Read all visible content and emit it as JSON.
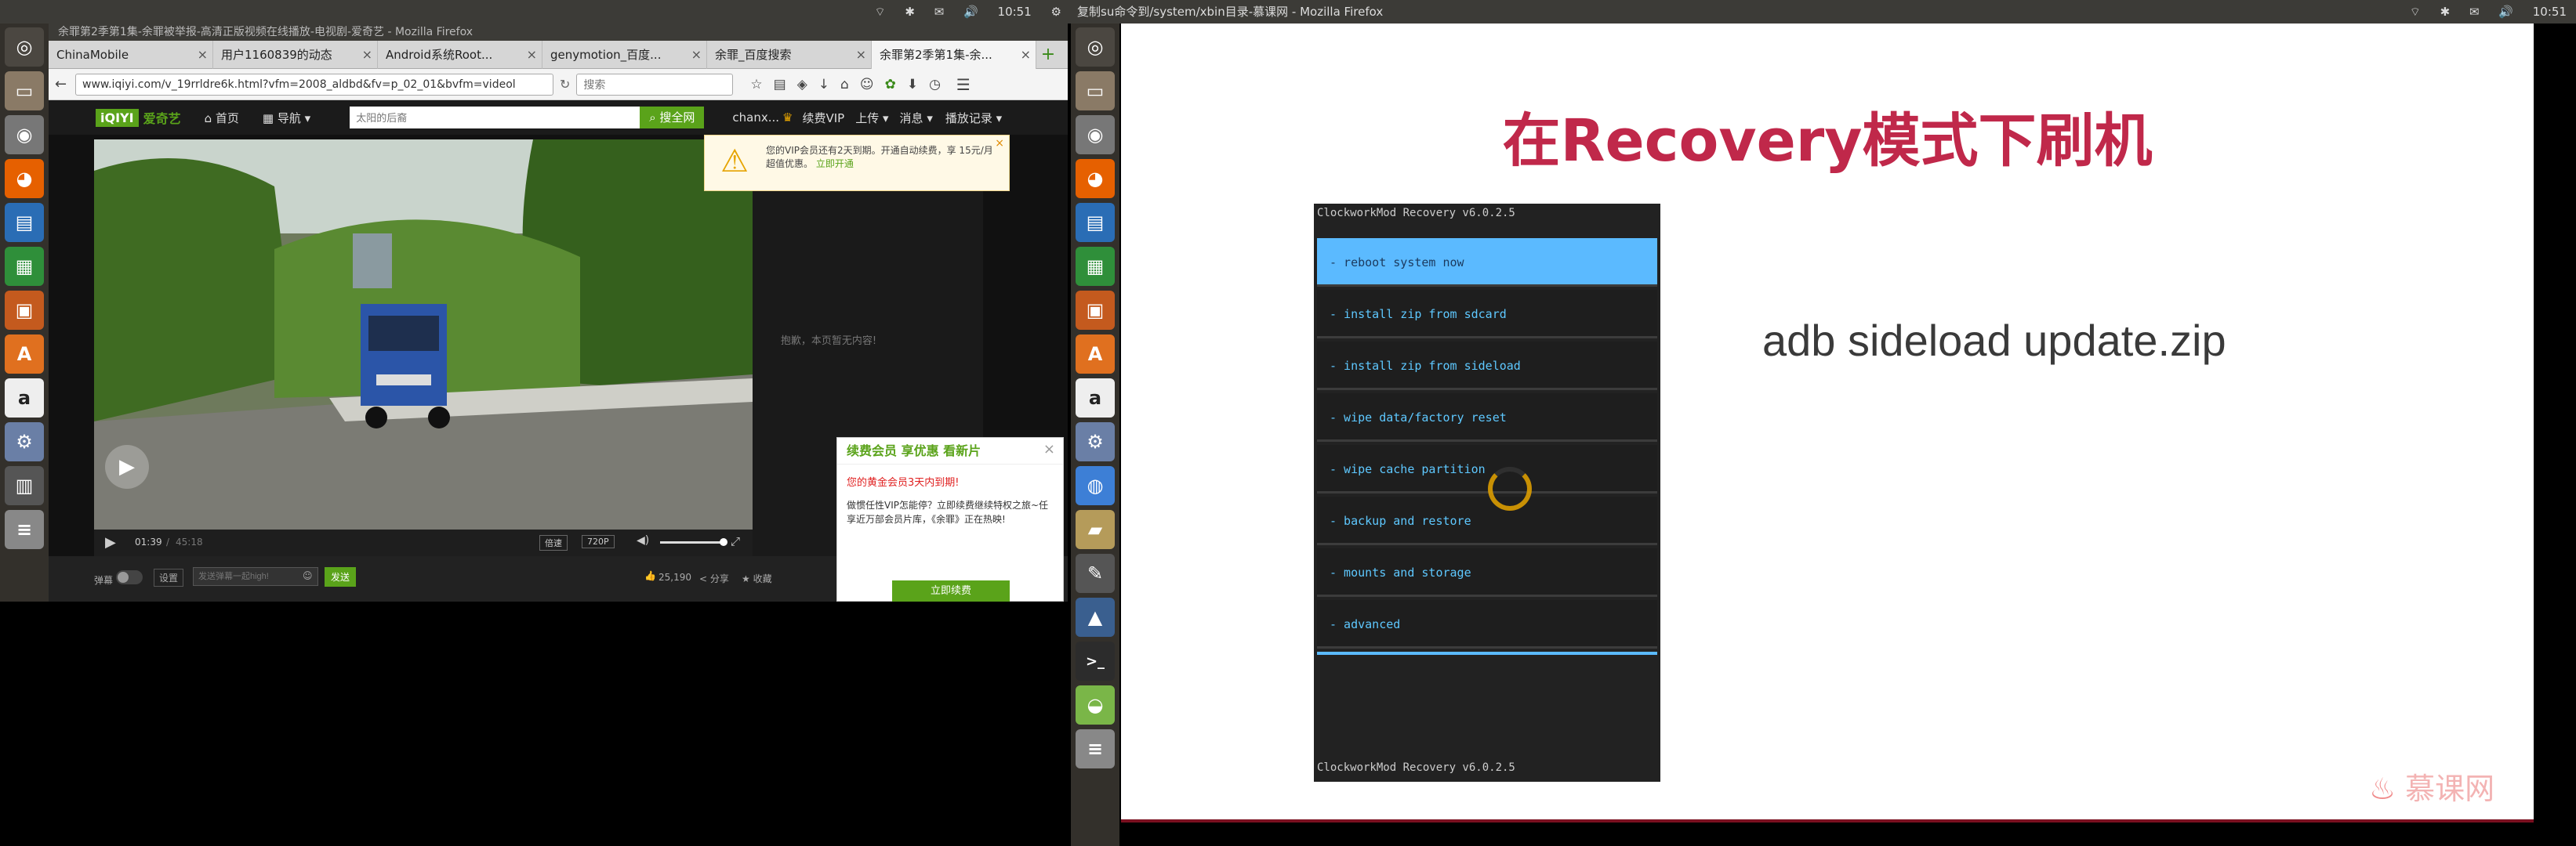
{
  "left_screen": {
    "topbar_time": "10:51",
    "window_title": "余罪第2季第1集-余罪被举报-高清正版视频在线播放-电视剧-爱奇艺 - Mozilla Firefox",
    "tabs": [
      {
        "label": "ChinaMobile"
      },
      {
        "label": "用户1160839的动态"
      },
      {
        "label": "Android系统Root..."
      },
      {
        "label": "genymotion_百度..."
      },
      {
        "label": "余罪_百度搜索"
      },
      {
        "label": "余罪第2季第1集-余..."
      }
    ],
    "url": "www.iqiyi.com/v_19rrldre6k.html?vfm=2008_aldbd&fv=p_02_01&bvfm=videol",
    "search_placeholder": "搜索",
    "iqiyi": {
      "logo": "爱奇艺",
      "nav_home": "首页",
      "nav_guide": "导航",
      "search_placeholder": "太阳的后裔",
      "search_button": "搜全网",
      "user": "chanx...",
      "renew_vip": "续费VIP",
      "upload": "上传",
      "messages": "消息",
      "history": "播放记录",
      "vip_notice": "您的VIP会员还有2天到期。开通自动续费，享 15元/月超值优惠。",
      "vip_notice_link": "立即开通",
      "side_empty": "抱歉，本页暂无内容!",
      "time_current": "01:39",
      "time_total": "45:18",
      "quality_1": "倍速",
      "quality_2": "720P",
      "danmu_label": "弹幕",
      "danmu_settings": "设置",
      "danmu_placeholder": "发送弹幕一起high!",
      "danmu_send": "发送",
      "likes": "25,190",
      "share": "分享",
      "collect": "收藏",
      "promo_title": "续费会员 享优惠 看新片",
      "promo_warning": "您的黄金会员3天内到期!",
      "promo_body": "做惯任性VIP怎能停？立即续费继续特权之旅~任享近万部会员片库，《余罪》正在热映!",
      "promo_button": "立即续费"
    }
  },
  "right_screen": {
    "topbar_title": "复制su命令到/system/xbin目录-慕课网 - Mozilla Firefox",
    "topbar_time": "10:51",
    "slide_title": "在Recovery模式下刷机",
    "command": "adb sideload update.zip",
    "recovery_header": "ClockworkMod Recovery v6.0.2.5",
    "recovery_footer": "ClockworkMod Recovery v6.0.2.5",
    "recovery_items": [
      "- reboot system now",
      "- install zip from sdcard",
      "- install zip from sideload",
      "- wipe data/factory reset",
      "- wipe cache partition",
      "- backup and restore",
      "- mounts and storage",
      "- advanced"
    ],
    "watermark": "慕课网"
  },
  "colors": {
    "accent_green": "#5aa31a",
    "slide_title": "#c0284a",
    "recovery_select": "#5bbaff"
  }
}
